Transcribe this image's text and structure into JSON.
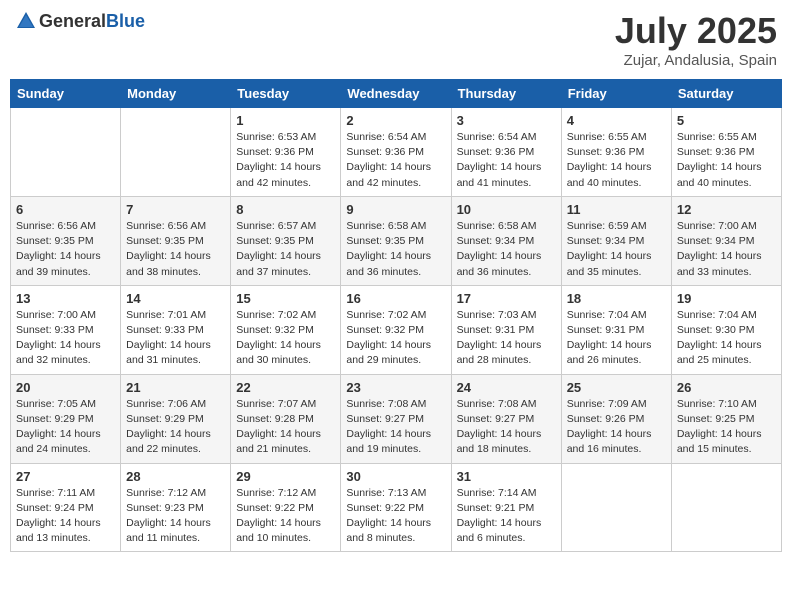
{
  "header": {
    "logo_general": "General",
    "logo_blue": "Blue",
    "month_title": "July 2025",
    "location": "Zujar, Andalusia, Spain"
  },
  "weekdays": [
    "Sunday",
    "Monday",
    "Tuesday",
    "Wednesday",
    "Thursday",
    "Friday",
    "Saturday"
  ],
  "weeks": [
    [
      {
        "day": "",
        "info": ""
      },
      {
        "day": "",
        "info": ""
      },
      {
        "day": "1",
        "info": "Sunrise: 6:53 AM\nSunset: 9:36 PM\nDaylight: 14 hours and 42 minutes."
      },
      {
        "day": "2",
        "info": "Sunrise: 6:54 AM\nSunset: 9:36 PM\nDaylight: 14 hours and 42 minutes."
      },
      {
        "day": "3",
        "info": "Sunrise: 6:54 AM\nSunset: 9:36 PM\nDaylight: 14 hours and 41 minutes."
      },
      {
        "day": "4",
        "info": "Sunrise: 6:55 AM\nSunset: 9:36 PM\nDaylight: 14 hours and 40 minutes."
      },
      {
        "day": "5",
        "info": "Sunrise: 6:55 AM\nSunset: 9:36 PM\nDaylight: 14 hours and 40 minutes."
      }
    ],
    [
      {
        "day": "6",
        "info": "Sunrise: 6:56 AM\nSunset: 9:35 PM\nDaylight: 14 hours and 39 minutes."
      },
      {
        "day": "7",
        "info": "Sunrise: 6:56 AM\nSunset: 9:35 PM\nDaylight: 14 hours and 38 minutes."
      },
      {
        "day": "8",
        "info": "Sunrise: 6:57 AM\nSunset: 9:35 PM\nDaylight: 14 hours and 37 minutes."
      },
      {
        "day": "9",
        "info": "Sunrise: 6:58 AM\nSunset: 9:35 PM\nDaylight: 14 hours and 36 minutes."
      },
      {
        "day": "10",
        "info": "Sunrise: 6:58 AM\nSunset: 9:34 PM\nDaylight: 14 hours and 36 minutes."
      },
      {
        "day": "11",
        "info": "Sunrise: 6:59 AM\nSunset: 9:34 PM\nDaylight: 14 hours and 35 minutes."
      },
      {
        "day": "12",
        "info": "Sunrise: 7:00 AM\nSunset: 9:34 PM\nDaylight: 14 hours and 33 minutes."
      }
    ],
    [
      {
        "day": "13",
        "info": "Sunrise: 7:00 AM\nSunset: 9:33 PM\nDaylight: 14 hours and 32 minutes."
      },
      {
        "day": "14",
        "info": "Sunrise: 7:01 AM\nSunset: 9:33 PM\nDaylight: 14 hours and 31 minutes."
      },
      {
        "day": "15",
        "info": "Sunrise: 7:02 AM\nSunset: 9:32 PM\nDaylight: 14 hours and 30 minutes."
      },
      {
        "day": "16",
        "info": "Sunrise: 7:02 AM\nSunset: 9:32 PM\nDaylight: 14 hours and 29 minutes."
      },
      {
        "day": "17",
        "info": "Sunrise: 7:03 AM\nSunset: 9:31 PM\nDaylight: 14 hours and 28 minutes."
      },
      {
        "day": "18",
        "info": "Sunrise: 7:04 AM\nSunset: 9:31 PM\nDaylight: 14 hours and 26 minutes."
      },
      {
        "day": "19",
        "info": "Sunrise: 7:04 AM\nSunset: 9:30 PM\nDaylight: 14 hours and 25 minutes."
      }
    ],
    [
      {
        "day": "20",
        "info": "Sunrise: 7:05 AM\nSunset: 9:29 PM\nDaylight: 14 hours and 24 minutes."
      },
      {
        "day": "21",
        "info": "Sunrise: 7:06 AM\nSunset: 9:29 PM\nDaylight: 14 hours and 22 minutes."
      },
      {
        "day": "22",
        "info": "Sunrise: 7:07 AM\nSunset: 9:28 PM\nDaylight: 14 hours and 21 minutes."
      },
      {
        "day": "23",
        "info": "Sunrise: 7:08 AM\nSunset: 9:27 PM\nDaylight: 14 hours and 19 minutes."
      },
      {
        "day": "24",
        "info": "Sunrise: 7:08 AM\nSunset: 9:27 PM\nDaylight: 14 hours and 18 minutes."
      },
      {
        "day": "25",
        "info": "Sunrise: 7:09 AM\nSunset: 9:26 PM\nDaylight: 14 hours and 16 minutes."
      },
      {
        "day": "26",
        "info": "Sunrise: 7:10 AM\nSunset: 9:25 PM\nDaylight: 14 hours and 15 minutes."
      }
    ],
    [
      {
        "day": "27",
        "info": "Sunrise: 7:11 AM\nSunset: 9:24 PM\nDaylight: 14 hours and 13 minutes."
      },
      {
        "day": "28",
        "info": "Sunrise: 7:12 AM\nSunset: 9:23 PM\nDaylight: 14 hours and 11 minutes."
      },
      {
        "day": "29",
        "info": "Sunrise: 7:12 AM\nSunset: 9:22 PM\nDaylight: 14 hours and 10 minutes."
      },
      {
        "day": "30",
        "info": "Sunrise: 7:13 AM\nSunset: 9:22 PM\nDaylight: 14 hours and 8 minutes."
      },
      {
        "day": "31",
        "info": "Sunrise: 7:14 AM\nSunset: 9:21 PM\nDaylight: 14 hours and 6 minutes."
      },
      {
        "day": "",
        "info": ""
      },
      {
        "day": "",
        "info": ""
      }
    ]
  ]
}
